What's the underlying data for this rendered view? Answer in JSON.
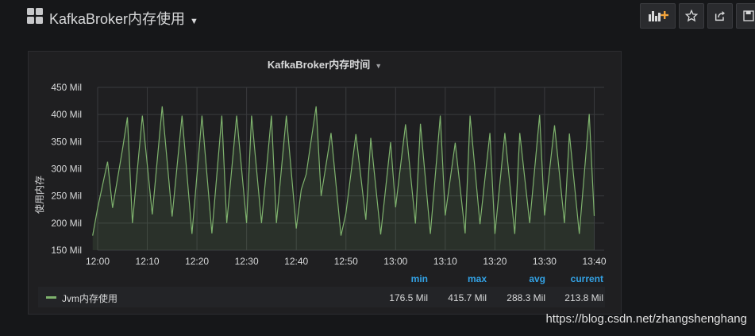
{
  "header": {
    "title": "KafkaBroker内存使用"
  },
  "panel": {
    "title": "KafkaBroker内存时间"
  },
  "chart_data": {
    "type": "line",
    "ylabel": "使用内存",
    "ylim": [
      150,
      450
    ],
    "yticks": [
      150,
      200,
      250,
      300,
      350,
      400,
      450
    ],
    "ytick_labels": [
      "150 Mil",
      "200 Mil",
      "250 Mil",
      "300 Mil",
      "350 Mil",
      "400 Mil",
      "450 Mil"
    ],
    "xlim": [
      0,
      102
    ],
    "xticks": [
      0,
      10,
      20,
      30,
      40,
      50,
      60,
      70,
      80,
      90,
      100
    ],
    "xtick_labels": [
      "12:00",
      "12:10",
      "12:20",
      "12:30",
      "12:40",
      "12:50",
      "13:00",
      "13:10",
      "13:20",
      "13:30",
      "13:40"
    ],
    "grid": true,
    "series": [
      {
        "name": "Jvm内存使用",
        "color": "#7eb26d",
        "x": [
          -1,
          0,
          2,
          3,
          5,
          6,
          7,
          9,
          11,
          13,
          15,
          17,
          19,
          21,
          23,
          25,
          26,
          28,
          30,
          31,
          33,
          35,
          36,
          38,
          40,
          41,
          42,
          44,
          45,
          47,
          49,
          50,
          52,
          54,
          55,
          57,
          59,
          60,
          62,
          64,
          65,
          67,
          69,
          70,
          72,
          74,
          75,
          77,
          79,
          80,
          82,
          84,
          85,
          87,
          89,
          90,
          92,
          94,
          95,
          97,
          99,
          100
        ],
        "y": [
          177,
          228,
          313,
          228,
          336,
          395,
          200,
          398,
          216,
          415,
          212,
          398,
          180,
          398,
          181,
          398,
          200,
          398,
          200,
          398,
          200,
          398,
          200,
          398,
          190,
          262,
          290,
          415,
          250,
          366,
          177,
          218,
          364,
          206,
          357,
          179,
          349,
          229,
          382,
          199,
          383,
          180,
          398,
          214,
          348,
          181,
          398,
          198,
          366,
          180,
          366,
          180,
          366,
          200,
          399,
          214,
          380,
          200,
          365,
          180,
          401,
          213
        ]
      }
    ]
  },
  "legend": {
    "headers": {
      "min": "min",
      "max": "max",
      "avg": "avg",
      "current": "current"
    },
    "series": [
      {
        "name": "Jvm内存使用",
        "min": "176.5 Mil",
        "max": "415.7 Mil",
        "avg": "288.3 Mil",
        "current": "213.8 Mil"
      }
    ]
  },
  "watermark": "https://blog.csdn.net/zhangshenghang"
}
